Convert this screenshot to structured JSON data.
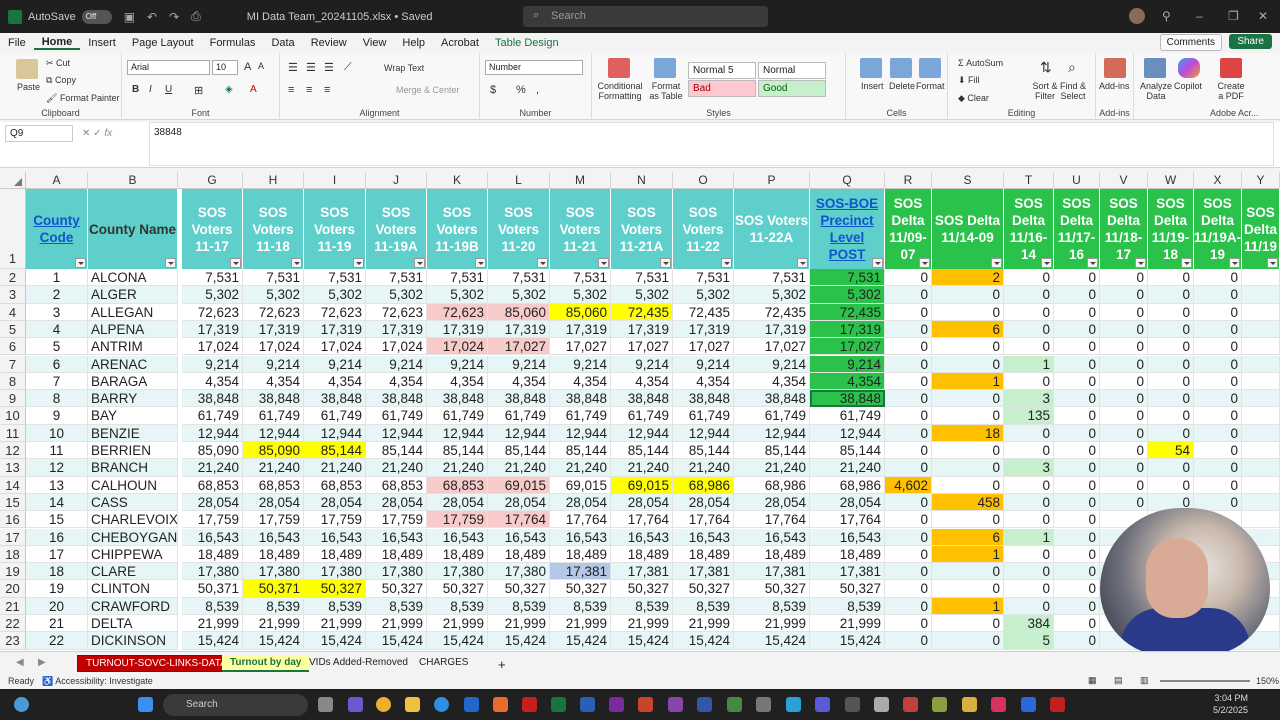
{
  "titlebar": {
    "autosave_label": "AutoSave",
    "autosave_state": "Off",
    "filename": "MI Data Team_20241105.xlsx  •  Saved",
    "search_placeholder": "Search"
  },
  "menu": [
    "File",
    "Home",
    "Insert",
    "Page Layout",
    "Formulas",
    "Data",
    "Review",
    "View",
    "Help",
    "Acrobat",
    "Table Design"
  ],
  "menu_active": "Home",
  "comments_label": "Comments",
  "share_label": "Share",
  "ribbon": {
    "clipboard": {
      "paste": "Paste",
      "cut": "Cut",
      "copy": "Copy",
      "format_painter": "Format Painter",
      "label": "Clipboard"
    },
    "font": {
      "name": "Arial",
      "size": "10",
      "label": "Font"
    },
    "alignment": {
      "wrap": "Wrap Text",
      "merge": "Merge & Center",
      "label": "Alignment"
    },
    "number": {
      "format": "Number",
      "label": "Number"
    },
    "styles": {
      "conditional": "Conditional Formatting",
      "format_table": "Format as Table",
      "normal5": "Normal 5",
      "normal": "Normal",
      "bad": "Bad",
      "good": "Good",
      "label": "Styles"
    },
    "cells": {
      "insert": "Insert",
      "delete": "Delete",
      "format": "Format",
      "label": "Cells"
    },
    "editing": {
      "autosum": "AutoSum",
      "fill": "Fill",
      "clear": "Clear",
      "sort": "Sort & Filter",
      "find": "Find & Select",
      "label": "Editing"
    },
    "addins": {
      "addins": "Add-ins",
      "label": "Add-ins"
    },
    "analyze": "Analyze Data",
    "copilot": "Copilot",
    "createpdf": "Create a PDF",
    "adobe_label": "Adobe Acr..."
  },
  "formula_bar": {
    "name_box": "Q9",
    "fx": "fx",
    "value": "38848"
  },
  "columns": [
    "A",
    "B",
    "G",
    "H",
    "I",
    "J",
    "K",
    "L",
    "M",
    "N",
    "O",
    "P",
    "Q",
    "R",
    "S",
    "T",
    "U",
    "V",
    "W",
    "X",
    "Y"
  ],
  "headers": {
    "A": "County Code",
    "B": "County Name",
    "G": "SOS Voters 11-17",
    "H": "SOS Voters 11-18",
    "I": "SOS Voters 11-19",
    "J": "SOS Voters 11-19A",
    "K": "SOS Voters 11-19B",
    "L": "SOS Voters 11-20",
    "M": "SOS Voters 11-21",
    "N": "SOS Voters 11-21A",
    "O": "SOS Voters 11-22",
    "P": "SOS Voters 11-22A",
    "Q": "SOS-BOE Precinct Level POST",
    "R": "SOS Delta 11/09-07",
    "S": "SOS Delta 11/14-09",
    "T": "SOS Delta 11/16-14",
    "U": "SOS Delta 11/17-16",
    "V": "SOS Delta 11/18-17",
    "W": "SOS Delta 11/19-18",
    "X": "SOS Delta 11/19A-19",
    "Y": "SOS Delta 11/19"
  },
  "rows": [
    {
      "r": "2",
      "code": "1",
      "name": "ALCONA",
      "v": [
        "7,531",
        "7,531",
        "7,531",
        "7,531",
        "7,531",
        "7,531",
        "7,531",
        "7,531",
        "7,531",
        "7,531",
        "7,531"
      ],
      "d": [
        "0",
        "2",
        "0",
        "0",
        "0",
        "0",
        "0"
      ]
    },
    {
      "r": "3",
      "code": "2",
      "name": "ALGER",
      "v": [
        "5,302",
        "5,302",
        "5,302",
        "5,302",
        "5,302",
        "5,302",
        "5,302",
        "5,302",
        "5,302",
        "5,302",
        "5,302"
      ],
      "d": [
        "0",
        "0",
        "0",
        "0",
        "0",
        "0",
        "0"
      ]
    },
    {
      "r": "4",
      "code": "3",
      "name": "ALLEGAN",
      "v": [
        "72,623",
        "72,623",
        "72,623",
        "72,623",
        "72,623",
        "85,060",
        "85,060",
        "72,435",
        "72,435",
        "72,435",
        "72,435"
      ],
      "d": [
        "0",
        "0",
        "0",
        "0",
        "0",
        "0",
        "0"
      ]
    },
    {
      "r": "5",
      "code": "4",
      "name": "ALPENA",
      "v": [
        "17,319",
        "17,319",
        "17,319",
        "17,319",
        "17,319",
        "17,319",
        "17,319",
        "17,319",
        "17,319",
        "17,319",
        "17,319"
      ],
      "d": [
        "0",
        "6",
        "0",
        "0",
        "0",
        "0",
        "0"
      ]
    },
    {
      "r": "6",
      "code": "5",
      "name": "ANTRIM",
      "v": [
        "17,024",
        "17,024",
        "17,024",
        "17,024",
        "17,024",
        "17,027",
        "17,027",
        "17,027",
        "17,027",
        "17,027",
        "17,027"
      ],
      "d": [
        "0",
        "0",
        "0",
        "0",
        "0",
        "0",
        "0"
      ]
    },
    {
      "r": "7",
      "code": "6",
      "name": "ARENAC",
      "v": [
        "9,214",
        "9,214",
        "9,214",
        "9,214",
        "9,214",
        "9,214",
        "9,214",
        "9,214",
        "9,214",
        "9,214",
        "9,214"
      ],
      "d": [
        "0",
        "0",
        "1",
        "0",
        "0",
        "0",
        "0"
      ]
    },
    {
      "r": "8",
      "code": "7",
      "name": "BARAGA",
      "v": [
        "4,354",
        "4,354",
        "4,354",
        "4,354",
        "4,354",
        "4,354",
        "4,354",
        "4,354",
        "4,354",
        "4,354",
        "4,354"
      ],
      "d": [
        "0",
        "1",
        "0",
        "0",
        "0",
        "0",
        "0"
      ]
    },
    {
      "r": "9",
      "code": "8",
      "name": "BARRY",
      "v": [
        "38,848",
        "38,848",
        "38,848",
        "38,848",
        "38,848",
        "38,848",
        "38,848",
        "38,848",
        "38,848",
        "38,848",
        "38,848"
      ],
      "d": [
        "0",
        "0",
        "3",
        "0",
        "0",
        "0",
        "0"
      ]
    },
    {
      "r": "10",
      "code": "9",
      "name": "BAY",
      "v": [
        "61,749",
        "61,749",
        "61,749",
        "61,749",
        "61,749",
        "61,749",
        "61,749",
        "61,749",
        "61,749",
        "61,749",
        "61,749"
      ],
      "d": [
        "0",
        "0",
        "135",
        "0",
        "0",
        "0",
        "0"
      ]
    },
    {
      "r": "11",
      "code": "10",
      "name": "BENZIE",
      "v": [
        "12,944",
        "12,944",
        "12,944",
        "12,944",
        "12,944",
        "12,944",
        "12,944",
        "12,944",
        "12,944",
        "12,944",
        "12,944"
      ],
      "d": [
        "0",
        "18",
        "0",
        "0",
        "0",
        "0",
        "0"
      ]
    },
    {
      "r": "12",
      "code": "11",
      "name": "BERRIEN",
      "v": [
        "85,090",
        "85,090",
        "85,144",
        "85,144",
        "85,144",
        "85,144",
        "85,144",
        "85,144",
        "85,144",
        "85,144",
        "85,144"
      ],
      "d": [
        "0",
        "0",
        "0",
        "0",
        "0",
        "54",
        "0"
      ]
    },
    {
      "r": "13",
      "code": "12",
      "name": "BRANCH",
      "v": [
        "21,240",
        "21,240",
        "21,240",
        "21,240",
        "21,240",
        "21,240",
        "21,240",
        "21,240",
        "21,240",
        "21,240",
        "21,240"
      ],
      "d": [
        "0",
        "0",
        "3",
        "0",
        "0",
        "0",
        "0"
      ]
    },
    {
      "r": "14",
      "code": "13",
      "name": "CALHOUN",
      "v": [
        "68,853",
        "68,853",
        "68,853",
        "68,853",
        "68,853",
        "69,015",
        "69,015",
        "69,015",
        "68,986",
        "68,986",
        "68,986"
      ],
      "d": [
        "4,602",
        "0",
        "0",
        "0",
        "0",
        "0",
        "0"
      ]
    },
    {
      "r": "15",
      "code": "14",
      "name": "CASS",
      "v": [
        "28,054",
        "28,054",
        "28,054",
        "28,054",
        "28,054",
        "28,054",
        "28,054",
        "28,054",
        "28,054",
        "28,054",
        "28,054"
      ],
      "d": [
        "0",
        "458",
        "0",
        "0",
        "0",
        "0",
        "0"
      ]
    },
    {
      "r": "16",
      "code": "15",
      "name": "CHARLEVOIX",
      "v": [
        "17,759",
        "17,759",
        "17,759",
        "17,759",
        "17,759",
        "17,764",
        "17,764",
        "17,764",
        "17,764",
        "17,764",
        "17,764"
      ],
      "d": [
        "0",
        "0",
        "0",
        "0",
        "",
        "",
        ""
      ]
    },
    {
      "r": "17",
      "code": "16",
      "name": "CHEBOYGAN",
      "v": [
        "16,543",
        "16,543",
        "16,543",
        "16,543",
        "16,543",
        "16,543",
        "16,543",
        "16,543",
        "16,543",
        "16,543",
        "16,543"
      ],
      "d": [
        "0",
        "6",
        "1",
        "0",
        "",
        "",
        ""
      ]
    },
    {
      "r": "18",
      "code": "17",
      "name": "CHIPPEWA",
      "v": [
        "18,489",
        "18,489",
        "18,489",
        "18,489",
        "18,489",
        "18,489",
        "18,489",
        "18,489",
        "18,489",
        "18,489",
        "18,489"
      ],
      "d": [
        "0",
        "1",
        "0",
        "0",
        "",
        "",
        ""
      ]
    },
    {
      "r": "19",
      "code": "18",
      "name": "CLARE",
      "v": [
        "17,380",
        "17,380",
        "17,380",
        "17,380",
        "17,380",
        "17,380",
        "17,381",
        "17,381",
        "17,381",
        "17,381",
        "17,381"
      ],
      "d": [
        "0",
        "0",
        "0",
        "0",
        "",
        "",
        ""
      ]
    },
    {
      "r": "20",
      "code": "19",
      "name": "CLINTON",
      "v": [
        "50,371",
        "50,371",
        "50,327",
        "50,327",
        "50,327",
        "50,327",
        "50,327",
        "50,327",
        "50,327",
        "50,327",
        "50,327"
      ],
      "d": [
        "0",
        "0",
        "0",
        "0",
        "",
        "",
        ""
      ]
    },
    {
      "r": "21",
      "code": "20",
      "name": "CRAWFORD",
      "v": [
        "8,539",
        "8,539",
        "8,539",
        "8,539",
        "8,539",
        "8,539",
        "8,539",
        "8,539",
        "8,539",
        "8,539",
        "8,539"
      ],
      "d": [
        "0",
        "1",
        "0",
        "0",
        "",
        "",
        ""
      ]
    },
    {
      "r": "22",
      "code": "21",
      "name": "DELTA",
      "v": [
        "21,999",
        "21,999",
        "21,999",
        "21,999",
        "21,999",
        "21,999",
        "21,999",
        "21,999",
        "21,999",
        "21,999",
        "21,999"
      ],
      "d": [
        "0",
        "0",
        "384",
        "0",
        "",
        "",
        ""
      ]
    },
    {
      "r": "23",
      "code": "22",
      "name": "DICKINSON",
      "v": [
        "15,424",
        "15,424",
        "15,424",
        "15,424",
        "15,424",
        "15,424",
        "15,424",
        "15,424",
        "15,424",
        "15,424",
        "15,424"
      ],
      "d": [
        "0",
        "0",
        "5",
        "0",
        "",
        "",
        ""
      ]
    }
  ],
  "highlights": {
    "yellow": [
      "4:M",
      "4:N",
      "12:H",
      "12:I",
      "14:N",
      "14:O",
      "20:H",
      "20:I",
      "12:W"
    ],
    "pink": [
      "4:K",
      "4:L",
      "6:K",
      "6:L",
      "14:K",
      "14:L",
      "16:K",
      "16:L"
    ],
    "orange": [
      "2:S",
      "5:S",
      "8:S",
      "11:S",
      "15:S",
      "17:S",
      "18:S",
      "21:S"
    ],
    "gold": [
      "14:R"
    ],
    "lightgreen": [
      "7:T",
      "9:T",
      "10:T",
      "13:T",
      "17:T",
      "22:T",
      "23:T"
    ],
    "blue": [
      "19:M"
    ],
    "qgreen_rows": [
      "2",
      "3",
      "4",
      "5",
      "6",
      "7",
      "8",
      "9"
    ]
  },
  "sheets": [
    "TURNOUT-SOVC-LINKS-DATA",
    "Turnout by day",
    "VIDs Added-Removed",
    "CHARGES"
  ],
  "active_sheet": "Turnout by day",
  "status": {
    "ready": "Ready",
    "accessibility": "Accessibility: Investigate",
    "zoom": "150%"
  },
  "taskbar": {
    "search": "Search",
    "time": "3:04 PM",
    "date": "5/2/2025"
  },
  "colors": {
    "teal": "#5fcfcc",
    "green": "#2bc24b",
    "excel_green": "#1a7343",
    "yellow": "#ffff00",
    "pink": "#f8cbcb",
    "orange": "#ffc000",
    "light_green": "#c6efce"
  }
}
